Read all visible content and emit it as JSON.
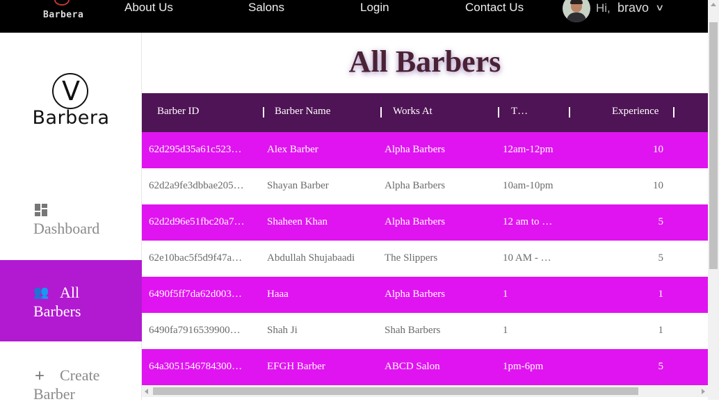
{
  "navbar": {
    "logo_text": "Barbera",
    "links": [
      "About Us",
      "Salons",
      "Login",
      "Contact Us"
    ],
    "greeting": "Hi,",
    "username": "bravo",
    "dropdown_icon": "chevron-down-icon"
  },
  "sidebar": {
    "logo_text": "Barbera",
    "logo_mark": "V",
    "items": [
      {
        "label": "Dashboard",
        "icon": "dashboard-icon"
      },
      {
        "label": "All Barbers",
        "icon": "people-icon",
        "active": true
      },
      {
        "label": "Create Barber",
        "icon": "plus-icon"
      }
    ]
  },
  "main": {
    "title": "All Barbers",
    "table": {
      "columns": [
        "Barber ID",
        "Barber Name",
        "Works At",
        "T…",
        "Experience"
      ],
      "rows": [
        [
          "62d295d35a61c523…",
          "Alex Barber",
          "Alpha Barbers",
          "12am-12pm",
          "10"
        ],
        [
          "62d2a9fe3dbbae205…",
          "Shayan Barber",
          "Alpha Barbers",
          "10am-10pm",
          "10"
        ],
        [
          "62d2d96e51fbc20a7…",
          "Shaheen Khan",
          "Alpha Barbers",
          "12 am to …",
          "5"
        ],
        [
          "62e10bac5f5d9f47a…",
          "Abdullah Shujabaadi",
          "The Slippers",
          "10 AM - …",
          "5"
        ],
        [
          "6490f5ff7da62d003…",
          "Haaa",
          "Alpha Barbers",
          "1",
          "1"
        ],
        [
          "6490fa7916539900…",
          "Shah Ji",
          "Shah Barbers",
          "1",
          "1"
        ],
        [
          "64a3051546784300…",
          "EFGH Barber",
          "ABCD Salon",
          "1pm-6pm",
          "5"
        ]
      ]
    }
  },
  "colors": {
    "navbar_bg": "#000000",
    "active_sidebar": "#b21ad1",
    "table_header": "#4f1455",
    "row_highlight": "#e014f0"
  }
}
